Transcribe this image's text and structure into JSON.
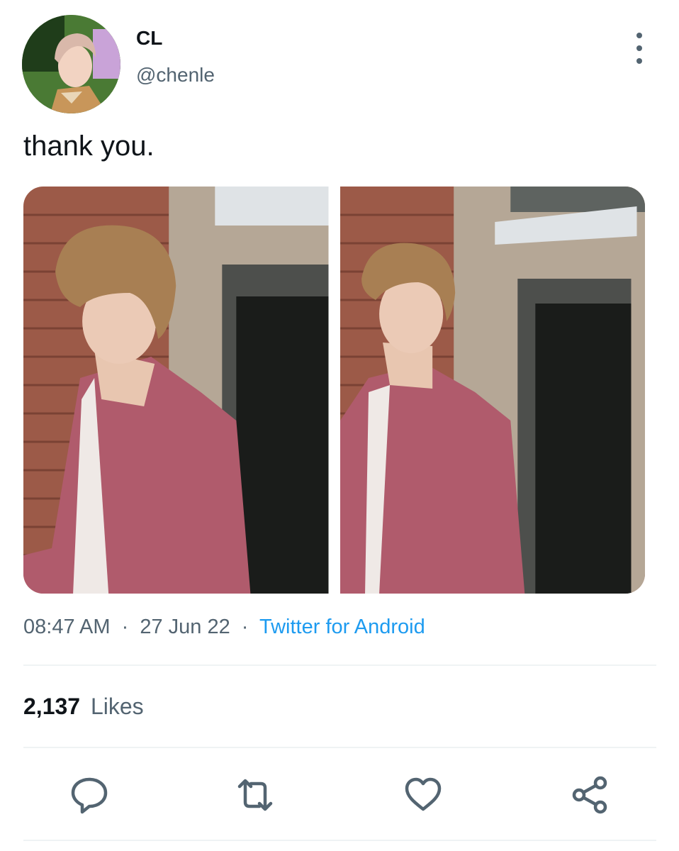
{
  "author": {
    "display_name": "CL",
    "handle": "@chenle",
    "avatar_icon": "profile-photo"
  },
  "tweet": {
    "text": "thank you."
  },
  "media": [
    {
      "icon": "photo-profile-view"
    },
    {
      "icon": "photo-front-view"
    }
  ],
  "meta": {
    "time": "08:47 AM",
    "separator1": "·",
    "date": "27 Jun 22",
    "separator2": "·",
    "source": "Twitter for Android"
  },
  "engagement": {
    "likes_count": "2,137",
    "likes_label": "Likes"
  },
  "actions": {
    "reply_icon": "speech-bubble-icon",
    "retweet_icon": "retweet-icon",
    "like_icon": "heart-icon",
    "share_icon": "share-icon"
  },
  "colors": {
    "accent": "#1d9bf0",
    "secondary_text": "#536471",
    "primary_text": "#0f1419",
    "divider": "#eff3f4"
  }
}
